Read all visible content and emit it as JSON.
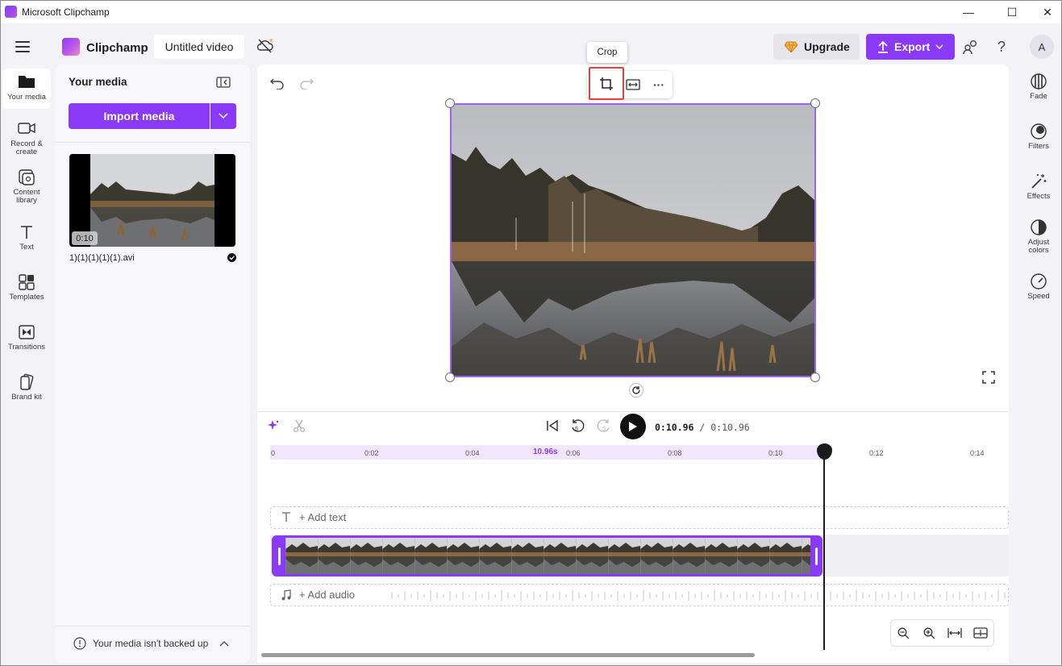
{
  "window": {
    "title": "Microsoft Clipchamp",
    "minimize": "—",
    "maximize": "☐",
    "close": "✕"
  },
  "header": {
    "brand": "Clipchamp",
    "project_title": "Untitled video",
    "upgrade_label": "Upgrade",
    "export_label": "Export",
    "avatar_initial": "A",
    "help_label": "?"
  },
  "left_rail": {
    "items": [
      {
        "label": "Your media",
        "icon": "folder-icon"
      },
      {
        "label": "Record &\ncreate",
        "icon": "camera-icon"
      },
      {
        "label": "Content\nlibrary",
        "icon": "content-library-icon"
      },
      {
        "label": "Text",
        "icon": "text-icon"
      },
      {
        "label": "Templates",
        "icon": "templates-icon"
      },
      {
        "label": "Transitions",
        "icon": "transitions-icon"
      },
      {
        "label": "Brand kit",
        "icon": "brand-kit-icon"
      }
    ]
  },
  "media_panel": {
    "title": "Your media",
    "import_label": "Import media",
    "item": {
      "duration": "0:10",
      "filename": "1)(1)(1)(1)(1).avi"
    },
    "backup_notice": "Your media isn't backed up"
  },
  "stage": {
    "tooltip": "Crop",
    "toolbar": {
      "more": "···"
    }
  },
  "right_rail": {
    "items": [
      {
        "label": "Fade",
        "icon": "fade-icon"
      },
      {
        "label": "Filters",
        "icon": "filters-icon"
      },
      {
        "label": "Effects",
        "icon": "effects-icon"
      },
      {
        "label": "Adjust\ncolors",
        "icon": "adjust-colors-icon"
      },
      {
        "label": "Speed",
        "icon": "speed-icon"
      }
    ]
  },
  "timeline": {
    "current_time": "0:10.96",
    "total_time": " / 0:10.96",
    "ruler_current": "10.96s",
    "ruler_ticks": [
      "0",
      "0:02",
      "0:04",
      "0:06",
      "0:08",
      "0:10",
      "0:12",
      "0:14"
    ],
    "add_text": "+ Add text",
    "add_audio": "+ Add audio",
    "skip_back": "5",
    "skip_fwd": "5"
  },
  "colors": {
    "accent": "#8a3af6",
    "highlight": "#e5403b"
  }
}
